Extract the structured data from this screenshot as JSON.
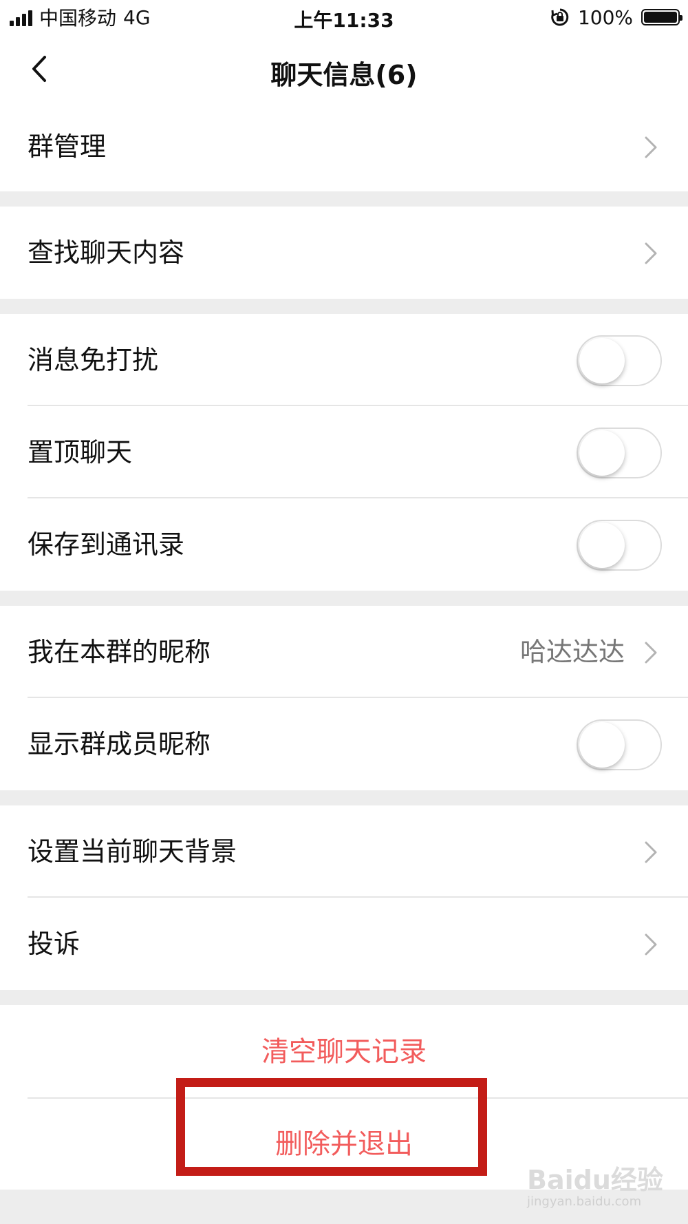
{
  "status_bar": {
    "carrier": "中国移动",
    "network": "4G",
    "time": "上午11:33",
    "battery_percent": "100%",
    "battery_level": 1.0
  },
  "nav": {
    "title": "聊天信息(6)",
    "back_icon": "chevron-left-icon"
  },
  "settings": {
    "group_manage": {
      "label": "群管理"
    },
    "search_chat": {
      "label": "查找聊天内容"
    },
    "mute": {
      "label": "消息免打扰",
      "enabled": false
    },
    "pin": {
      "label": "置顶聊天",
      "enabled": false
    },
    "save_contacts": {
      "label": "保存到通讯录",
      "enabled": false
    },
    "my_nickname": {
      "label": "我在本群的昵称",
      "value": "哈达达达"
    },
    "show_nicknames": {
      "label": "显示群成员昵称",
      "enabled": false
    },
    "background": {
      "label": "设置当前聊天背景"
    },
    "report": {
      "label": "投诉"
    }
  },
  "actions": {
    "clear_history": "清空聊天记录",
    "delete_exit": "删除并退出"
  },
  "watermark": {
    "logo": "Baidu经验",
    "url": "jingyan.baidu.com"
  },
  "colors": {
    "action_red": "#f25c5c",
    "highlight_red": "#c31d17",
    "background": "#ededed"
  }
}
